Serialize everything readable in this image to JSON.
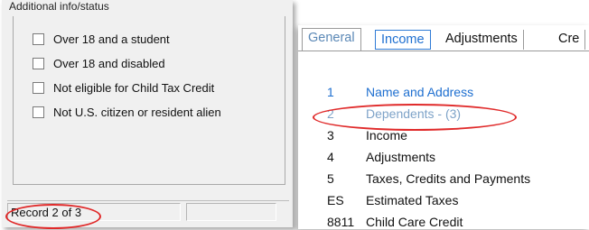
{
  "left_panel": {
    "header": "Additional info/status",
    "checkboxes": [
      {
        "label": "Over 18 and a student",
        "checked": false
      },
      {
        "label": "Over 18 and disabled",
        "checked": false
      },
      {
        "label": "Not eligible for Child Tax Credit",
        "checked": false
      },
      {
        "label": "Not U.S. citizen or resident alien",
        "checked": false
      }
    ],
    "status_bar": {
      "record": "Record 2 of 3"
    }
  },
  "right_panel": {
    "tabs": [
      "General",
      "Income",
      "Adjustments",
      "Cre"
    ],
    "menu": [
      {
        "num": "1",
        "label": "Name and Address",
        "style": "link"
      },
      {
        "num": "2",
        "label": "Dependents - (3)",
        "style": "disabled"
      },
      {
        "num": "3",
        "label": "Income",
        "style": "normal"
      },
      {
        "num": "4",
        "label": "Adjustments",
        "style": "normal"
      },
      {
        "num": "5",
        "label": "Taxes, Credits and Payments",
        "style": "normal"
      },
      {
        "num": "ES",
        "label": "Estimated Taxes",
        "style": "normal"
      },
      {
        "num": "8811",
        "label": "Child Care Credit",
        "style": "normal"
      }
    ]
  },
  "colors": {
    "link": "#1e6fd0",
    "disabled": "#7ea3c8",
    "highlight_oval": "#e02a2a"
  }
}
